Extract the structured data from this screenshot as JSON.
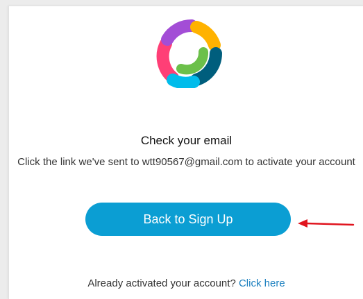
{
  "logo": {
    "icon": "webex-logo-icon",
    "colors": [
      "#ff3f76",
      "#a34dd6",
      "#ffb200",
      "#6cc04a",
      "#005e7d",
      "#00bceb"
    ]
  },
  "heading": "Check your email",
  "message": "Click the link we've sent to wtt90567@gmail.com to activate your account",
  "back_button_label": "Back to Sign Up",
  "annotation": {
    "icon": "red-arrow-icon",
    "color": "#e0141e"
  },
  "footer": {
    "prompt": "Already activated your account?",
    "link_label": "Click here"
  },
  "colors": {
    "button": "#0b9ed3",
    "link": "#1a7fbf"
  }
}
